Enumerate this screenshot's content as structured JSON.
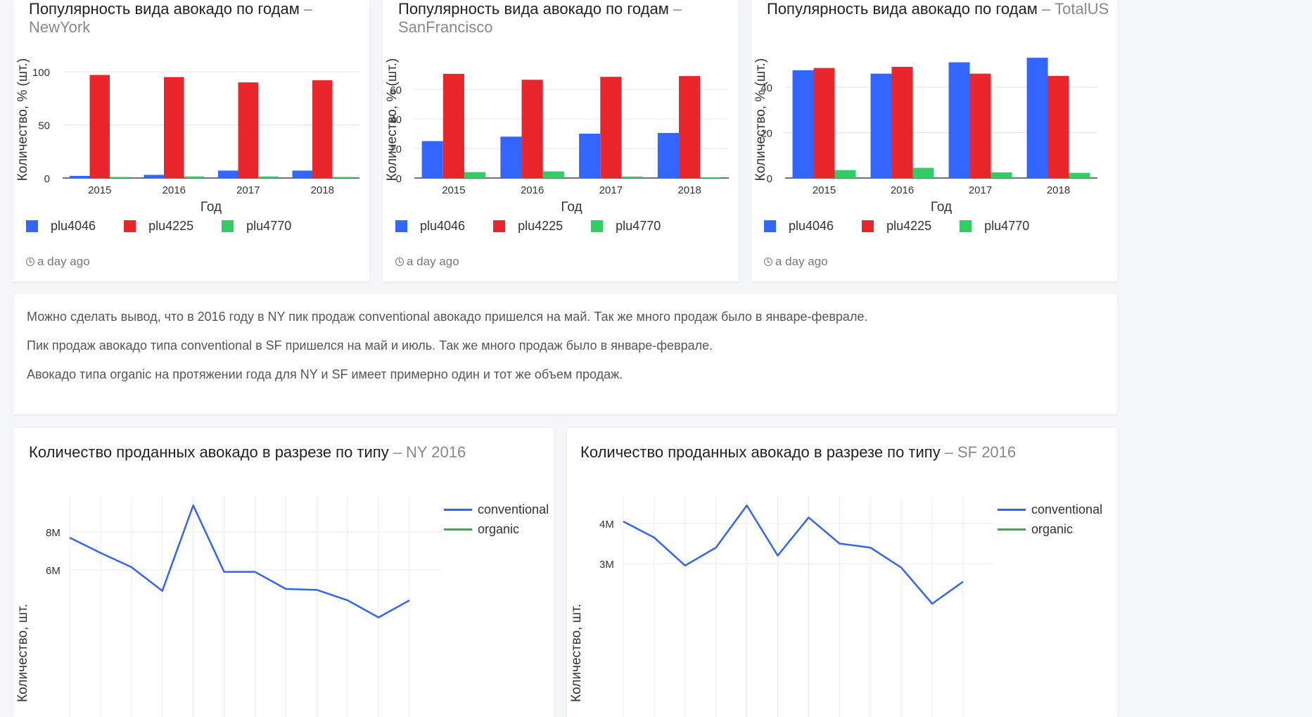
{
  "colors": {
    "plu4046": "#3366ff",
    "plu4225": "#e8262b",
    "plu4770": "#33cc66",
    "conventional": "#3366ee",
    "organic": "#22bb44"
  },
  "bar_cards": [
    {
      "title": "Популярность вида авокадо по годам",
      "subtitle": "NewYork",
      "timestamp": "a day ago"
    },
    {
      "title": "Популярность вида авокадо по годам",
      "subtitle": "SanFrancisco",
      "timestamp": "a day ago"
    },
    {
      "title": "Популярность вида авокадо по годам",
      "subtitle": "TotalUS",
      "timestamp": "a day ago"
    }
  ],
  "text_card": {
    "paragraphs": [
      "Можно сделать вывод, что в 2016 году в NY пик продаж conventional авокадо пришелся на май. Так же много продаж было в январе-феврале.",
      "Пик продаж авокадо типа conventional в SF пришелся на май и июль. Так же много продаж было в январе-феврале.",
      "Авокадо типа organic на протяжении года для NY и SF имеет примерно один и тот же объем продаж."
    ]
  },
  "line_cards": [
    {
      "title": "Количество проданных авокадо в разрезе по типу",
      "subtitle": "NY 2016"
    },
    {
      "title": "Количество проданных авокадо в разрезе по типу",
      "subtitle": "SF 2016"
    }
  ],
  "chart_data": [
    {
      "type": "bar",
      "categories": [
        "2015",
        "2016",
        "2017",
        "2018"
      ],
      "series": [
        {
          "name": "plu4046",
          "values": [
            2,
            3,
            7,
            7
          ]
        },
        {
          "name": "plu4225",
          "values": [
            97,
            95,
            90,
            92
          ]
        },
        {
          "name": "plu4770",
          "values": [
            1,
            1.5,
            1.5,
            1
          ]
        }
      ],
      "xlabel": "Год",
      "ylabel": "Количество, % (шт.)",
      "yticks": [
        "0",
        "50",
        "100"
      ],
      "ylim": [
        0,
        100
      ]
    },
    {
      "type": "bar",
      "categories": [
        "2015",
        "2016",
        "2017",
        "2018"
      ],
      "series": [
        {
          "name": "plu4046",
          "values": [
            25,
            28,
            30,
            30.5
          ]
        },
        {
          "name": "plu4225",
          "values": [
            70.5,
            66.5,
            68.5,
            69
          ]
        },
        {
          "name": "plu4770",
          "values": [
            4,
            4.5,
            1,
            0.5
          ]
        }
      ],
      "xlabel": "Год",
      "ylabel": "Количество, % (шт.)",
      "yticks": [
        "0",
        "20",
        "40",
        "60"
      ],
      "ylim": [
        0,
        60
      ]
    },
    {
      "type": "bar",
      "categories": [
        "2015",
        "2016",
        "2017",
        "2018"
      ],
      "series": [
        {
          "name": "plu4046",
          "values": [
            47.5,
            46,
            51,
            53
          ]
        },
        {
          "name": "plu4225",
          "values": [
            48.5,
            49,
            46,
            45
          ]
        },
        {
          "name": "plu4770",
          "values": [
            3.5,
            4.5,
            2.5,
            2.3
          ]
        }
      ],
      "xlabel": "Год",
      "ylabel": "Количество, % (шт.)",
      "yticks": [
        "0",
        "20",
        "40"
      ],
      "ylim": [
        0,
        40
      ]
    },
    {
      "type": "line",
      "ylabel": "Количество, шт.",
      "yticks": [
        "6M",
        "8M"
      ],
      "ylim": [
        6000000,
        8000000
      ],
      "series": [
        {
          "name": "conventional",
          "values": [
            7700000,
            6900000,
            6150000,
            4900000,
            9400000,
            5900000,
            5900000,
            5000000,
            4950000,
            4400000,
            3500000,
            4400000
          ]
        },
        {
          "name": "organic",
          "values": []
        }
      ]
    },
    {
      "type": "line",
      "ylabel": "Количество, шт.",
      "yticks": [
        "3M",
        "4M"
      ],
      "ylim": [
        3000000,
        4000000
      ],
      "series": [
        {
          "name": "conventional",
          "values": [
            4050000,
            3650000,
            2950000,
            3400000,
            4450000,
            3200000,
            4150000,
            3500000,
            3400000,
            2900000,
            2000000,
            2550000
          ]
        },
        {
          "name": "organic",
          "values": []
        }
      ]
    }
  ]
}
